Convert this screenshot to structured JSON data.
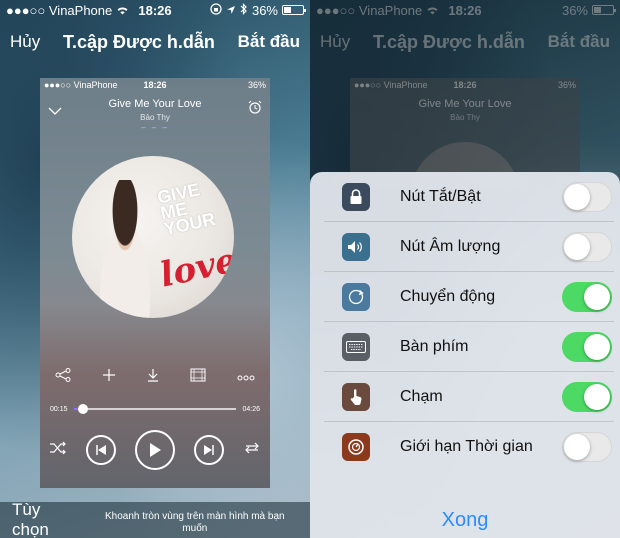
{
  "status": {
    "carrier": "●●●○○ VinaPhone",
    "time": "18:26",
    "battery": "36%"
  },
  "nav": {
    "cancel": "Hủy",
    "title": "T.cập Được h.dẫn",
    "start": "Bắt đầu"
  },
  "preview": {
    "status_carrier": "●●●○○ VinaPhone",
    "status_time": "18:26",
    "status_battery": "36%",
    "song_title": "Give Me Your Love",
    "artist": "Bảo Thy",
    "elapsed": "00:15",
    "duration": "04:26",
    "progress_fraction": 0.06,
    "album_text_main": "love",
    "album_text_top": "GIVE ME YOUR",
    "album_artist": "BẢO THY"
  },
  "bottom": {
    "options": "Tùy chọn",
    "hint": "Khoanh tròn vùng trên màn hình mà bạn muốn"
  },
  "sheet": {
    "items": [
      {
        "label": "Nút Tắt/Bật",
        "icon": "lock-icon",
        "color": "#3b4a5c",
        "on": false
      },
      {
        "label": "Nút Âm lượng",
        "icon": "speaker-icon",
        "color": "#3b6f8e",
        "on": false
      },
      {
        "label": "Chuyển động",
        "icon": "rotate-icon",
        "color": "#4c7a9e",
        "on": true
      },
      {
        "label": "Bàn phím",
        "icon": "keyboard-icon",
        "color": "#5a5f66",
        "on": true
      },
      {
        "label": "Chạm",
        "icon": "hand-icon",
        "color": "#6a4a3c",
        "on": true
      },
      {
        "label": "Giới hạn Thời gian",
        "icon": "timer-icon",
        "color": "#8b3a1e",
        "on": false
      }
    ],
    "done": "Xong"
  },
  "colors": {
    "accent_blue": "#2a8cff",
    "toggle_on": "#4cd964",
    "progress_fill": "#9b6cff"
  }
}
